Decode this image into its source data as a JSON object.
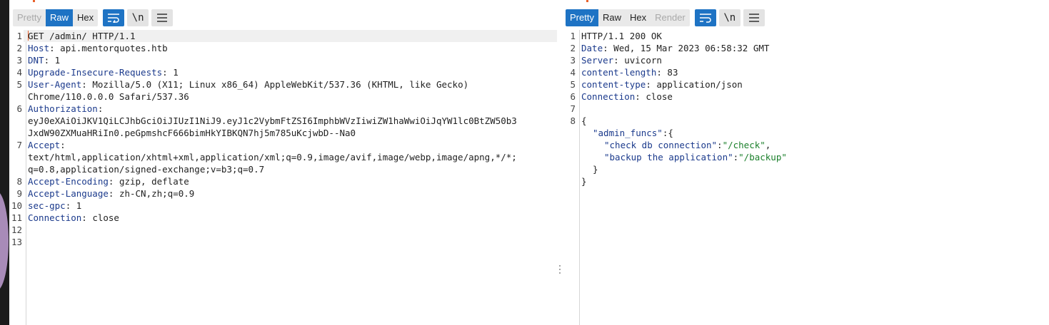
{
  "request": {
    "tabs": [
      {
        "label": "Pretty",
        "state": "inactive"
      },
      {
        "label": "Raw",
        "state": "active"
      },
      {
        "label": "Hex",
        "state": "normal"
      }
    ],
    "buttons": {
      "wrap_icon": "wrap-lines-icon",
      "newline_label": "\\n",
      "menu_icon": "menu-icon"
    },
    "lines": [
      {
        "n": "1",
        "method": "GET",
        "rest": " /admin/ HTTP/1.1"
      },
      {
        "n": "2",
        "name": "Host",
        "value": " api.mentorquotes.htb"
      },
      {
        "n": "3",
        "name": "DNT",
        "value": " 1"
      },
      {
        "n": "4",
        "name": "Upgrade-Insecure-Requests",
        "value": " 1"
      },
      {
        "n": "5",
        "name": "User-Agent",
        "value": " Mozilla/5.0 (X11; Linux x86_64) AppleWebKit/537.36 (KHTML, like Gecko)",
        "cont": [
          "Chrome/110.0.0.0 Safari/537.36"
        ]
      },
      {
        "n": "6",
        "name": "Authorization",
        "value": "",
        "cont": [
          "eyJ0eXAiOiJKV1QiLCJhbGciOiJIUzI1NiJ9.eyJ1c2VybmFtZSI6ImphbWVzIiwiZW1haWwiOiJqYW1lc0BtZW50b3",
          "JxdW90ZXMuaHRiIn0.peGpmshcF666bimHkYIBKQN7hj5m785uKcjwbD--Na0"
        ]
      },
      {
        "n": "7",
        "name": "Accept",
        "value": "",
        "cont": [
          "text/html,application/xhtml+xml,application/xml;q=0.9,image/avif,image/webp,image/apng,*/*;",
          "q=0.8,application/signed-exchange;v=b3;q=0.7"
        ]
      },
      {
        "n": "8",
        "name": "Accept-Encoding",
        "value": " gzip, deflate"
      },
      {
        "n": "9",
        "name": "Accept-Language",
        "value": " zh-CN,zh;q=0.9"
      },
      {
        "n": "10",
        "name": "sec-gpc",
        "value": " 1"
      },
      {
        "n": "11",
        "name": "Connection",
        "value": " close"
      },
      {
        "n": "12"
      },
      {
        "n": "13"
      }
    ]
  },
  "response": {
    "tabs": [
      {
        "label": "Pretty",
        "state": "active"
      },
      {
        "label": "Raw",
        "state": "normal"
      },
      {
        "label": "Hex",
        "state": "normal"
      },
      {
        "label": "Render",
        "state": "disabled"
      }
    ],
    "buttons": {
      "wrap_icon": "wrap-lines-icon",
      "newline_label": "\\n",
      "menu_icon": "menu-icon"
    },
    "status_line": "HTTP/1.1 200 OK",
    "headers": [
      {
        "n": "2",
        "name": "Date",
        "value": " Wed, 15 Mar 2023 06:58:32 GMT"
      },
      {
        "n": "3",
        "name": "Server",
        "value": " uvicorn"
      },
      {
        "n": "4",
        "name": "content-length",
        "value": " 83"
      },
      {
        "n": "5",
        "name": "content-type",
        "value": " application/json"
      },
      {
        "n": "6",
        "name": "Connection",
        "value": " close"
      }
    ],
    "blank_line_number": "7",
    "body_line_number": "8",
    "json": {
      "open_brace": "{",
      "outer_key": "\"admin_funcs\"",
      "outer_sep": ":{",
      "entries": [
        {
          "key": "\"check db connection\"",
          "sep": ":",
          "value": "\"/check\"",
          "trail": ","
        },
        {
          "key": "\"backup the application\"",
          "sep": ":",
          "value": "\"/backup\"",
          "trail": ""
        }
      ],
      "inner_close": "}",
      "close_brace": "}"
    }
  },
  "colors": {
    "accent": "#1e73c4",
    "header_name": "#1b3a8c",
    "json_string": "#1a7f2a",
    "caret": "#e8622c"
  }
}
